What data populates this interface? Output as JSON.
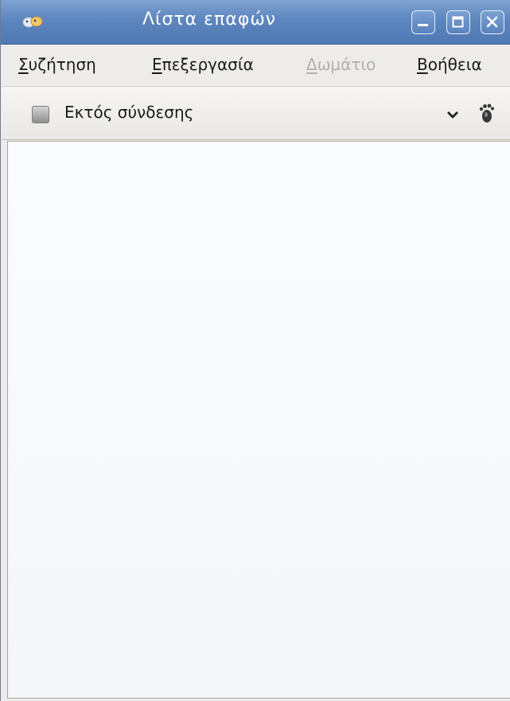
{
  "window": {
    "title": "Λίστα επαφών",
    "app_icon": "pidgin-app-icon",
    "controls": [
      "minimize-icon",
      "maximize-icon",
      "close-icon"
    ]
  },
  "menubar": {
    "items": [
      {
        "mnemonic": "Σ",
        "rest": "υζήτηση",
        "enabled": true
      },
      {
        "mnemonic": "Ε",
        "rest": "πεξεργασία",
        "enabled": true
      },
      {
        "mnemonic": "Δ",
        "rest": "ωμάτιο",
        "enabled": false
      },
      {
        "mnemonic": "Β",
        "rest": "οήθεια",
        "enabled": true
      }
    ]
  },
  "status": {
    "label": "Εκτός σύνδεσης",
    "status_icon": "offline-status-icon",
    "dropdown_icon": "chevron-down-icon",
    "extra_icon": "footprint-icon"
  },
  "contacts": [],
  "colors": {
    "titlebar": "#5d86be",
    "menu_bg": "#edeceb",
    "disabled_text": "#b2b0ac",
    "list_bg": "#f7f9fb"
  }
}
